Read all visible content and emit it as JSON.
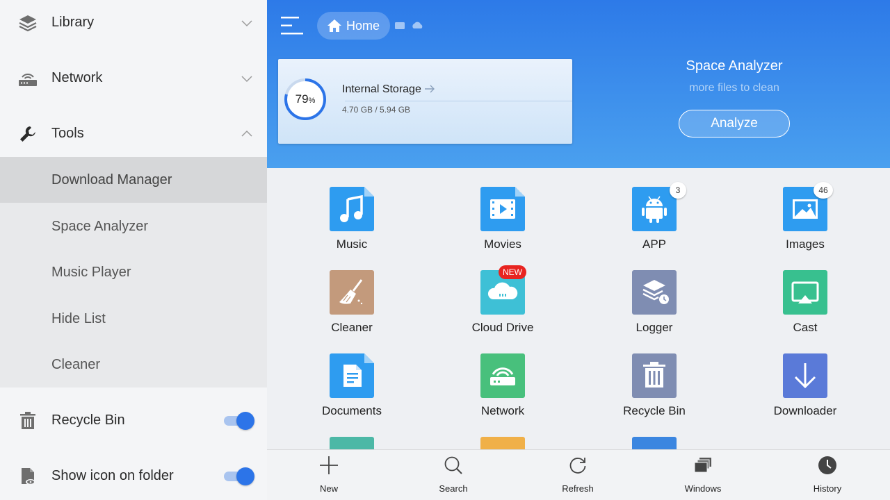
{
  "sidebar": {
    "library": "Library",
    "network": "Network",
    "tools": "Tools",
    "tools_items": [
      "Download Manager",
      "Space Analyzer",
      "Music Player",
      "Hide List",
      "Cleaner"
    ],
    "recycle_bin": "Recycle Bin",
    "show_icon_on_folder": "Show icon on folder",
    "recycle_bin_toggle": "on",
    "show_icon_toggle": "on"
  },
  "header": {
    "home": "Home"
  },
  "storage": {
    "percent": "79",
    "percent_sign": "%",
    "title": "Internal Storage",
    "size": "4.70 GB / 5.94 GB"
  },
  "analyzer": {
    "title": "Space Analyzer",
    "subtitle": "more files to clean",
    "button": "Analyze"
  },
  "tiles": {
    "music": "Music",
    "movies": "Movies",
    "app": "APP",
    "app_badge": "3",
    "images": "Images",
    "images_badge": "46",
    "cleaner": "Cleaner",
    "cloud_drive": "Cloud Drive",
    "cloud_badge": "NEW",
    "logger": "Logger",
    "cast": "Cast",
    "documents": "Documents",
    "network": "Network",
    "recycle_bin": "Recycle Bin",
    "downloader": "Downloader"
  },
  "bottombar": {
    "new": "New",
    "search": "Search",
    "refresh": "Refresh",
    "windows": "Windows",
    "history": "History"
  },
  "colors": {
    "accent": "#2c74e8",
    "hero_top": "#2d7ae8",
    "hero_bottom": "#4aa0ef",
    "new_badge": "#e82420"
  }
}
